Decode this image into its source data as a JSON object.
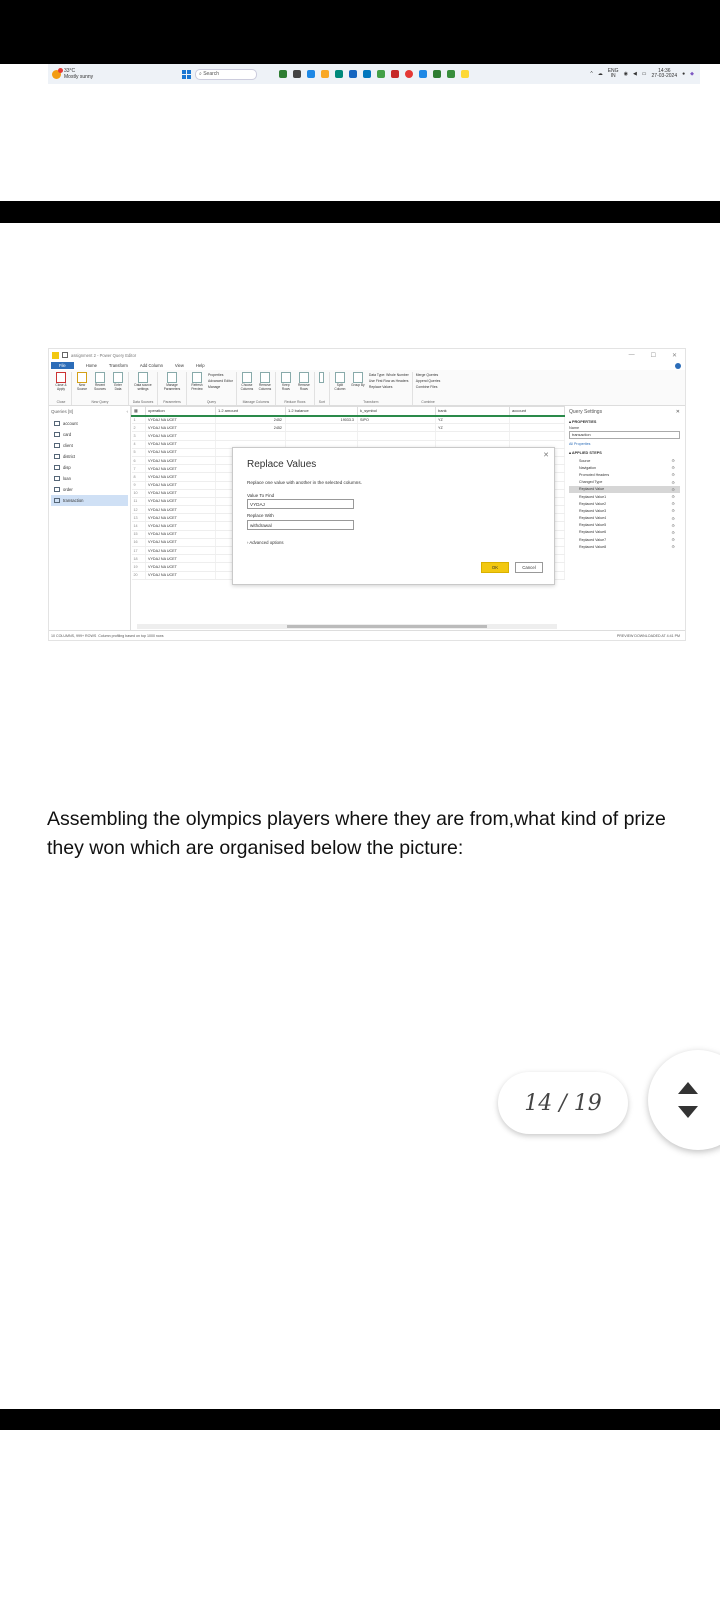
{
  "taskbar": {
    "weather_temp": "33°C",
    "weather_desc": "Mostly sunny",
    "search_placeholder": "Search",
    "lang": "ENG",
    "lang_region": "IN",
    "time": "14:36",
    "date": "27-03-2024"
  },
  "powerquery": {
    "window_title": "assignment 2 - Power Query Editor",
    "menu": [
      "File",
      "Home",
      "Transform",
      "Add Column",
      "View",
      "Help"
    ],
    "ribbon": {
      "close": {
        "buttons": [
          "Close & Apply"
        ],
        "group": "Close"
      },
      "new_query": {
        "buttons": [
          "New Source",
          "Recent Sources",
          "Enter Data"
        ],
        "group": "New Query"
      },
      "data_sources": {
        "buttons": [
          "Data source settings"
        ],
        "group": "Data Sources"
      },
      "parameters": {
        "buttons": [
          "Manage Parameters"
        ],
        "group": "Parameters"
      },
      "query": {
        "buttons": [
          "Refresh Preview"
        ],
        "list": [
          "Properties",
          "Advanced Editor",
          "Manage"
        ],
        "group": "Query"
      },
      "manage_columns": {
        "buttons": [
          "Choose Columns",
          "Remove Columns"
        ],
        "group": "Manage Columns"
      },
      "reduce_rows": {
        "buttons": [
          "Keep Rows",
          "Remove Rows"
        ],
        "group": "Reduce Rows"
      },
      "sort": {
        "group": "Sort"
      },
      "transform": {
        "buttons": [
          "Split Column",
          "Group By"
        ],
        "list": [
          "Data Type: Whole Number",
          "Use First Row as Headers",
          "Replace Values"
        ],
        "group": "Transform"
      },
      "combine": {
        "list": [
          "Merge Queries",
          "Append Queries",
          "Combine Files"
        ],
        "group": "Combine"
      }
    },
    "queries_header": "Queries [8]",
    "queries": [
      "account",
      "card",
      "client",
      "district",
      "disp",
      "loan",
      "order",
      "transaction"
    ],
    "columns": [
      "operation",
      "1.2 amount",
      "1.2 balance",
      "k_symbol",
      "bank",
      "account"
    ],
    "rows": [
      {
        "n": "1",
        "operation": "VYDAJ NA UCET",
        "amount": "2452",
        "balance": "19033.3",
        "k_symbol": "SIPO",
        "bank": "YZ"
      },
      {
        "n": "2",
        "operation": "VYDAJ NA UCET",
        "amount": "2452",
        "balance": "",
        "k_symbol": "",
        "bank": "YZ"
      },
      {
        "n": "3",
        "operation": "VYDAJ NA UCET",
        "amount": "",
        "balance": "",
        "k_symbol": "",
        "bank": ""
      },
      {
        "n": "4",
        "operation": "VYDAJ NA UCET",
        "amount": "",
        "balance": "",
        "k_symbol": "",
        "bank": ""
      },
      {
        "n": "5",
        "operation": "VYDAJ NA UCET",
        "amount": "",
        "balance": "",
        "k_symbol": "",
        "bank": ""
      },
      {
        "n": "6",
        "operation": "VYDAJ NA UCET",
        "amount": "",
        "balance": "",
        "k_symbol": "",
        "bank": ""
      },
      {
        "n": "7",
        "operation": "VYDAJ NA UCET",
        "amount": "",
        "balance": "",
        "k_symbol": "",
        "bank": ""
      },
      {
        "n": "8",
        "operation": "VYDAJ NA UCET",
        "amount": "",
        "balance": "",
        "k_symbol": "",
        "bank": ""
      },
      {
        "n": "9",
        "operation": "VYDAJ NA UCET",
        "amount": "",
        "balance": "",
        "k_symbol": "",
        "bank": ""
      },
      {
        "n": "10",
        "operation": "VYDAJ NA UCET",
        "amount": "",
        "balance": "",
        "k_symbol": "",
        "bank": ""
      },
      {
        "n": "11",
        "operation": "VYDAJ NA UCET",
        "amount": "",
        "balance": "",
        "k_symbol": "",
        "bank": ""
      },
      {
        "n": "12",
        "operation": "VYDAJ NA UCET",
        "amount": "",
        "balance": "",
        "k_symbol": "",
        "bank": ""
      },
      {
        "n": "13",
        "operation": "VYDAJ NA UCET",
        "amount": "",
        "balance": "",
        "k_symbol": "",
        "bank": ""
      },
      {
        "n": "14",
        "operation": "VYDAJ NA UCET",
        "amount": "",
        "balance": "",
        "k_symbol": "",
        "bank": ""
      },
      {
        "n": "15",
        "operation": "VYDAJ NA UCET",
        "amount": "",
        "balance": "",
        "k_symbol": "",
        "bank": ""
      },
      {
        "n": "16",
        "operation": "VYDAJ NA UCET",
        "amount": "",
        "balance": "",
        "k_symbol": "",
        "bank": ""
      },
      {
        "n": "17",
        "operation": "VYDAJ NA UCET",
        "amount": "2452",
        "balance": "",
        "k_symbol": "",
        "bank": "YZ"
      },
      {
        "n": "18",
        "operation": "VYDAJ NA UCET",
        "amount": "2452",
        "balance": "22037.9",
        "k_symbol": "SIPO",
        "bank": "YZ"
      },
      {
        "n": "19",
        "operation": "VYDAJ NA UCET",
        "amount": "2452",
        "balance": "22085.7",
        "k_symbol": "SIPO",
        "bank": "YZ"
      },
      {
        "n": "20",
        "operation": "VYDAJ NA UCET",
        "amount": "2452",
        "balance": "22138.3",
        "k_symbol": "SIPO",
        "bank": "YZ"
      }
    ],
    "settings": {
      "title": "Query Settings",
      "properties_label": "PROPERTIES",
      "name_label": "Name",
      "name_value": "transaction",
      "all_properties": "All Properties",
      "applied_steps_label": "APPLIED STEPS",
      "steps": [
        "Source",
        "Navigation",
        "Promoted Headers",
        "Changed Type",
        "Replaced Value",
        "Replaced Value1",
        "Replaced Value2",
        "Replaced Value3",
        "Replaced Value4",
        "Replaced Value5",
        "Replaced Value6",
        "Replaced Value7",
        "Replaced Value8"
      ],
      "selected_step": 4
    },
    "status_left": "10 COLUMNS, 999+ ROWS",
    "status_mid": "Column profiling based on top 1000 rows",
    "status_right": "PREVIEW DOWNLOADED AT 4:41 PM",
    "dialog": {
      "title": "Replace Values",
      "description": "Replace one value with another in the selected columns.",
      "find_label": "Value To Find",
      "find_value": "VYDAJ",
      "replace_label": "Replace With",
      "replace_value": "withdrawal",
      "advanced": "Advanced options",
      "ok": "OK",
      "cancel": "Cancel"
    }
  },
  "caption": "Assembling the olympics players where they are from,what kind of prize they won which are organised below the picture:",
  "pager": {
    "current": "14",
    "separator": "/",
    "total": "19"
  }
}
